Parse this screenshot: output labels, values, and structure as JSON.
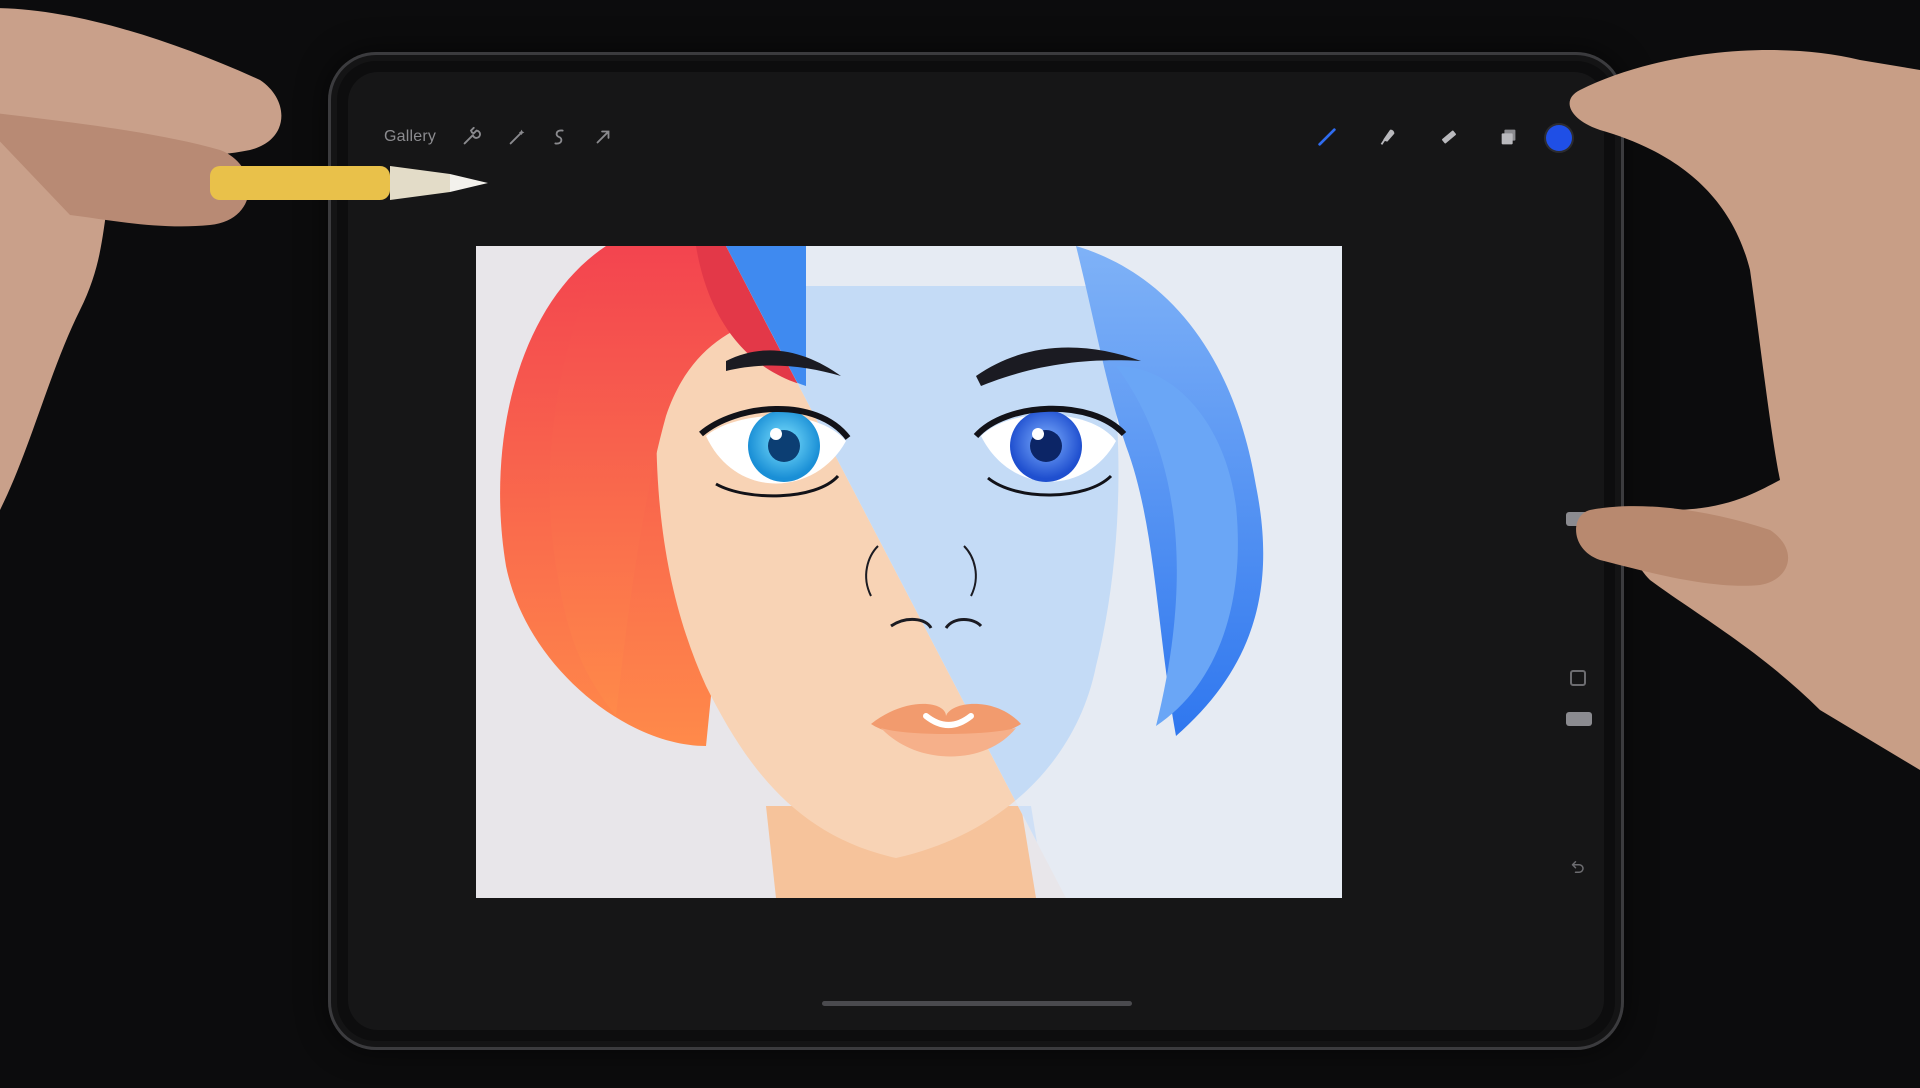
{
  "app": {
    "gallery_label": "Gallery"
  },
  "toolbar_left": [
    {
      "name": "actions-wrench-icon"
    },
    {
      "name": "adjustments-wand-icon"
    },
    {
      "name": "selection-s-icon"
    },
    {
      "name": "transform-arrow-icon"
    }
  ],
  "toolbar_right": [
    {
      "name": "brush-icon"
    },
    {
      "name": "smudge-icon"
    },
    {
      "name": "eraser-icon"
    },
    {
      "name": "layers-icon"
    }
  ],
  "colors": {
    "active_color": "#1f4fe6",
    "hair_warm": "#f0584a",
    "hair_cool": "#5b9cf5",
    "skin_warm": "#f7c9a6",
    "skin_cool": "#bcd6f5",
    "canvas_bg": "#e7e9ef"
  }
}
